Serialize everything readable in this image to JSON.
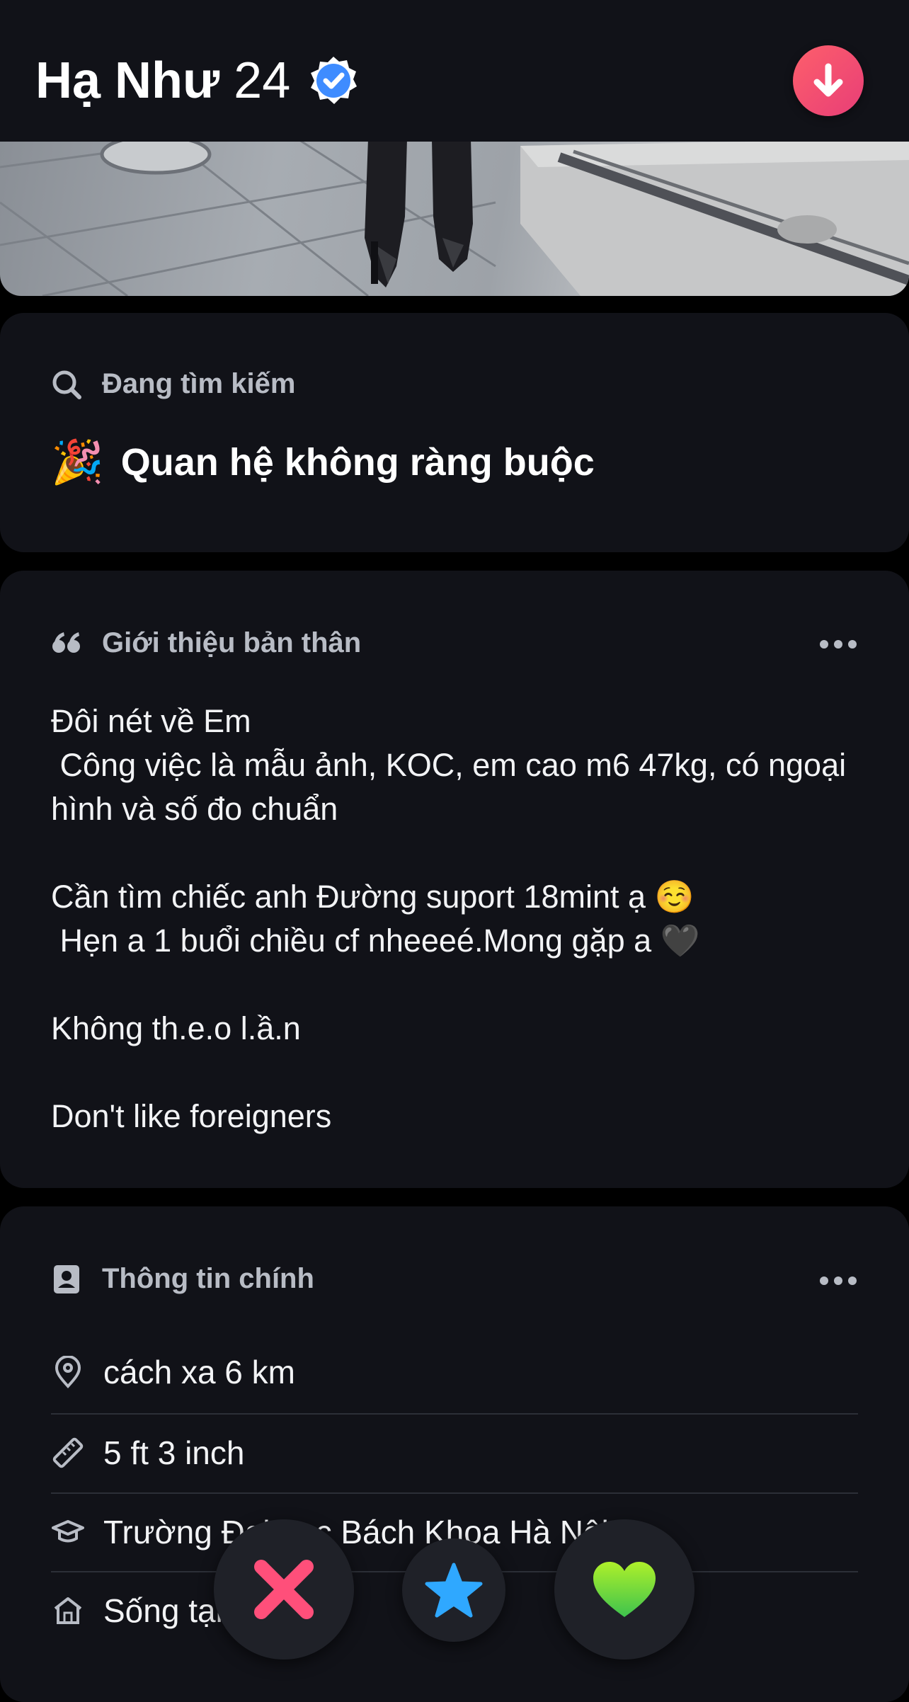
{
  "profile": {
    "name": "Hạ Như",
    "age": "24"
  },
  "looking_for": {
    "header": "Đang tìm kiếm",
    "value": "Quan hệ không ràng buộc",
    "emoji": "🎉"
  },
  "bio": {
    "header": "Giới thiệu bản thân",
    "text": "Đôi nét về Em\n Công việc là mẫu ảnh, KOC, em cao m6 47kg, có ngoại hình và số đo chuẩn\n\nCần tìm chiếc anh Đường suport 18mint ạ ☺️\n Hẹn a 1 buổi chiều cf nheeeé.Mong gặp a 🖤\n\nKhông th.e.o l.ầ.n\n\nDon't like foreigners"
  },
  "basics": {
    "header": "Thông tin chính",
    "rows": [
      {
        "icon": "location-pin-icon",
        "text": "cách xa 6 km"
      },
      {
        "icon": "ruler-icon",
        "text": "5 ft 3 inch"
      },
      {
        "icon": "graduation-cap-icon",
        "text": "Trường Đại học Bách Khoa Hà Nội"
      },
      {
        "icon": "home-icon",
        "text": "Sống tại"
      }
    ]
  },
  "actions": {
    "nope": "nope-x-icon",
    "super_like": "star-icon",
    "like": "heart-icon"
  },
  "colors": {
    "verified": "#3f8cff",
    "collapse_button": "#fd5f6b",
    "nope": "#ff4f7a",
    "super_like": "#2fa8ff",
    "like": "#6fe33f",
    "card_bg": "#111218"
  }
}
